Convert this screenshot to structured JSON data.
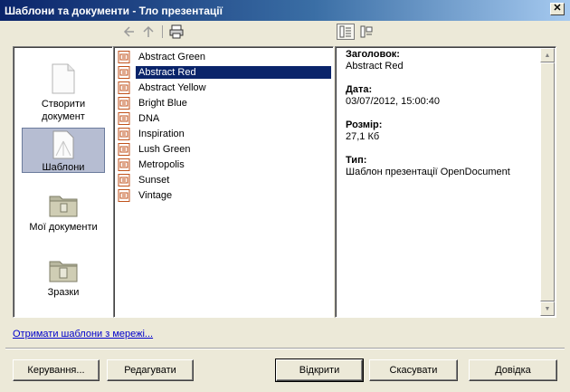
{
  "window": {
    "title": "Шаблони та документи - Тло презентації"
  },
  "toolbar": {
    "back_icon": "back-arrow-icon",
    "up_icon": "up-arrow-icon",
    "print_icon": "printer-icon",
    "view_details_icon": "details-view-icon",
    "view_preview_icon": "preview-view-icon"
  },
  "categories": [
    {
      "label": "Створити документ",
      "icon": "new-document-icon"
    },
    {
      "label": "Шаблони",
      "icon": "templates-icon"
    },
    {
      "label": "Мої документи",
      "icon": "my-documents-folder-icon"
    },
    {
      "label": "Зразки",
      "icon": "samples-folder-icon"
    }
  ],
  "files": [
    "Abstract Green",
    "Abstract Red",
    "Abstract Yellow",
    "Bright Blue",
    "DNA",
    "Inspiration",
    "Lush Green",
    "Metropolis",
    "Sunset",
    "Vintage"
  ],
  "selected_file": "Abstract Red",
  "info": {
    "title_label": "Заголовок:",
    "title_value": "Abstract Red",
    "date_label": "Дата:",
    "date_value": "03/07/2012, 15:00:40",
    "size_label": "Розмір:",
    "size_value": "27,1 Кб",
    "type_label": "Тип:",
    "type_value": "Шаблон презентації OpenDocument"
  },
  "link": "Отримати шаблони з мережі...",
  "buttons": {
    "manage": "Керування...",
    "edit": "Редагувати",
    "open": "Відкрити",
    "cancel": "Скасувати",
    "help": "Довідка"
  },
  "colors": {
    "selection": "#0a246a",
    "category_selected": "#b6bdd2",
    "file_icon": "#c0521b"
  }
}
